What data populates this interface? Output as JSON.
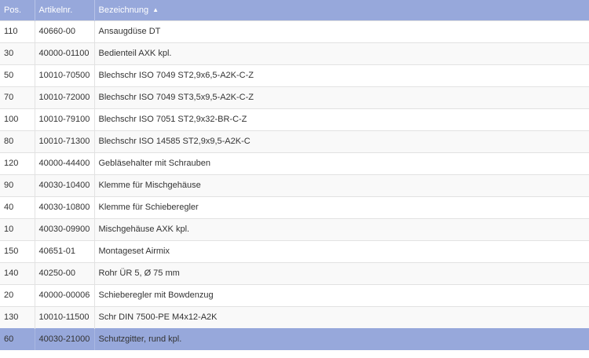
{
  "columns": {
    "pos": "Pos.",
    "artikelnr": "Artikelnr.",
    "bezeichnung": "Bezeichnung",
    "sort_icon": "sort-ascending-icon",
    "sort_glyph": "▲"
  },
  "selected_index": 14,
  "colors": {
    "header_bg": "#97a8db",
    "selected_bg": "#97a8db",
    "row_alt_bg": "#f9f9f9"
  },
  "rows": [
    {
      "pos": "110",
      "artikelnr": "40660-00",
      "bezeichnung": "Ansaugdüse DT"
    },
    {
      "pos": "30",
      "artikelnr": "40000-01100",
      "bezeichnung": "Bedienteil AXK kpl."
    },
    {
      "pos": "50",
      "artikelnr": "10010-70500",
      "bezeichnung": "Blechschr ISO 7049 ST2,9x6,5-A2K-C-Z"
    },
    {
      "pos": "70",
      "artikelnr": "10010-72000",
      "bezeichnung": "Blechschr ISO 7049 ST3,5x9,5-A2K-C-Z"
    },
    {
      "pos": "100",
      "artikelnr": "10010-79100",
      "bezeichnung": "Blechschr ISO 7051 ST2,9x32-BR-C-Z"
    },
    {
      "pos": "80",
      "artikelnr": "10010-71300",
      "bezeichnung": "Blechschr ISO 14585 ST2,9x9,5-A2K-C"
    },
    {
      "pos": "120",
      "artikelnr": "40000-44400",
      "bezeichnung": "Gebläsehalter mit Schrauben"
    },
    {
      "pos": "90",
      "artikelnr": "40030-10400",
      "bezeichnung": "Klemme für Mischgehäuse"
    },
    {
      "pos": "40",
      "artikelnr": "40030-10800",
      "bezeichnung": "Klemme für Schieberegler"
    },
    {
      "pos": "10",
      "artikelnr": "40030-09900",
      "bezeichnung": "Mischgehäuse AXK kpl."
    },
    {
      "pos": "150",
      "artikelnr": "40651-01",
      "bezeichnung": "Montageset Airmix"
    },
    {
      "pos": "140",
      "artikelnr": "40250-00",
      "bezeichnung": "Rohr ÜR 5, Ø 75 mm"
    },
    {
      "pos": "20",
      "artikelnr": "40000-00006",
      "bezeichnung": "Schieberegler mit Bowdenzug"
    },
    {
      "pos": "130",
      "artikelnr": "10010-11500",
      "bezeichnung": "Schr DIN 7500-PE M4x12-A2K"
    },
    {
      "pos": "60",
      "artikelnr": "40030-21000",
      "bezeichnung": "Schutzgitter, rund kpl."
    }
  ]
}
